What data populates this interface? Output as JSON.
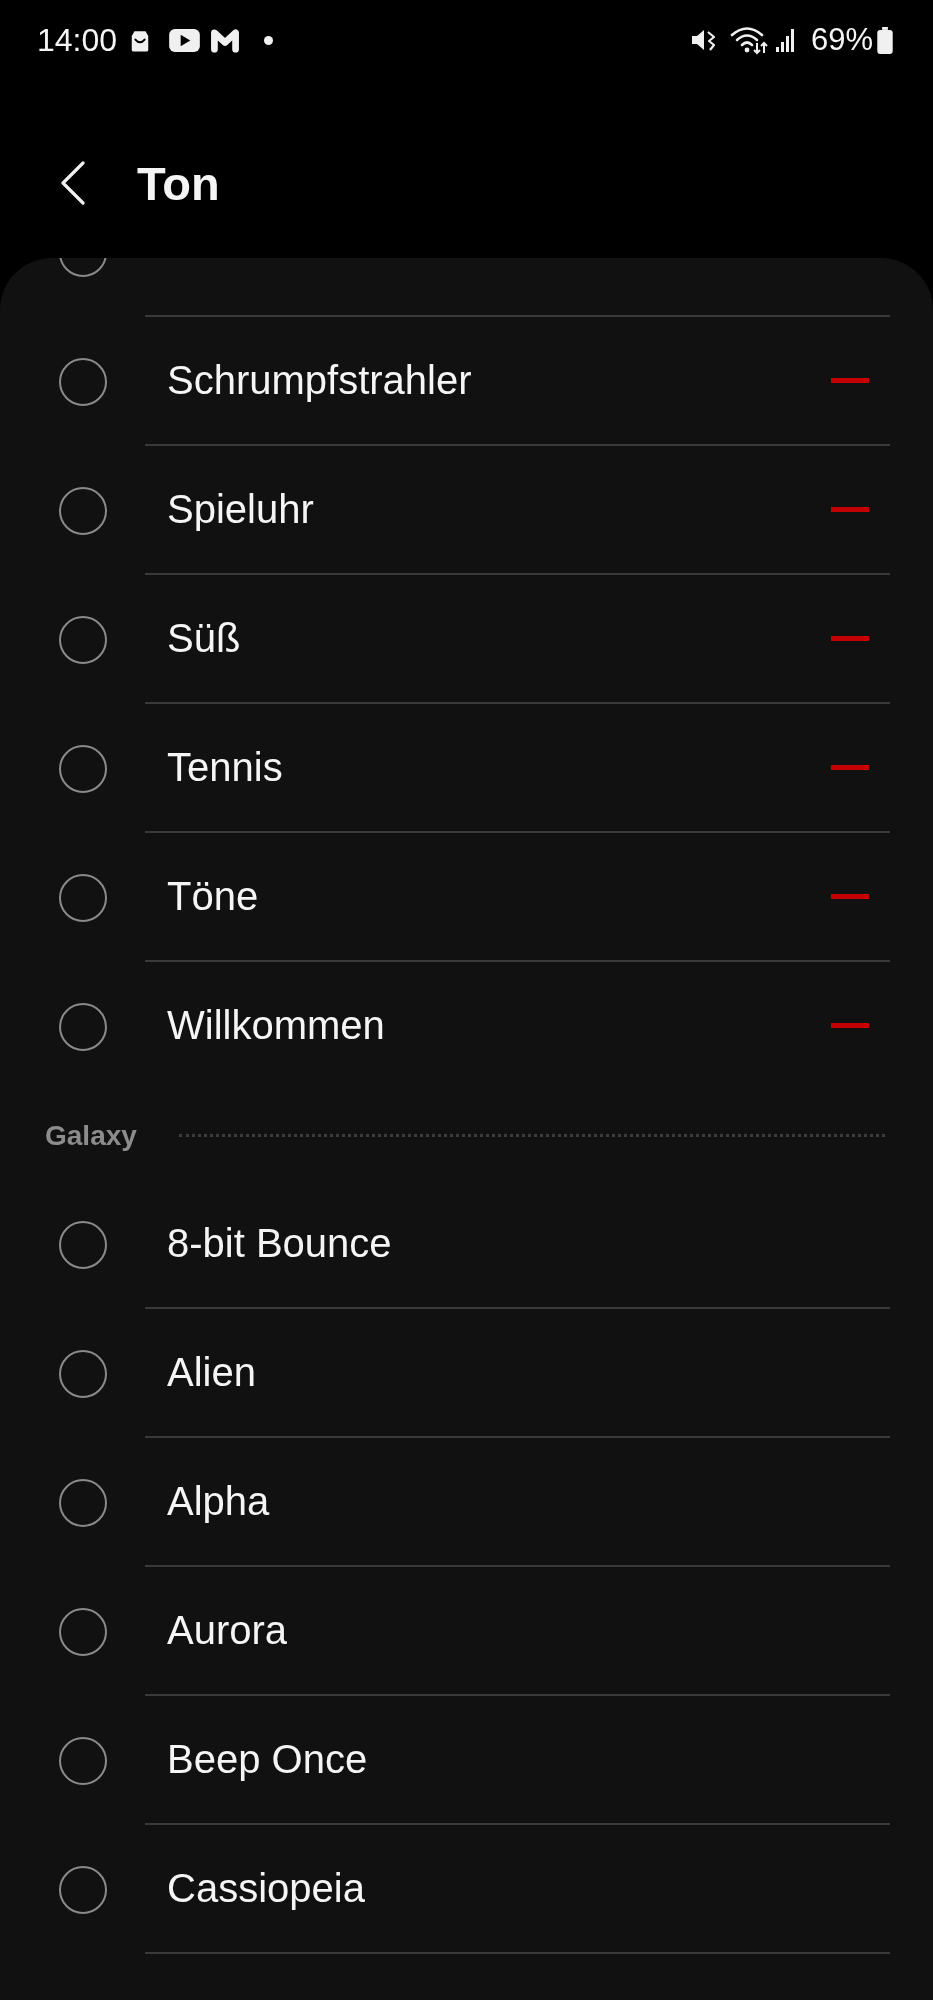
{
  "status_bar": {
    "time": "14:00",
    "battery": "69%"
  },
  "header": {
    "title": "Ton"
  },
  "sections": [
    {
      "items": [
        {
          "selected": false
        },
        {
          "name": "Schrumpfstrahler",
          "selected": false,
          "removable": true
        },
        {
          "name": "Spieluhr",
          "selected": false,
          "removable": true
        },
        {
          "name": "Süß",
          "selected": false,
          "removable": true
        },
        {
          "name": "Tennis",
          "selected": false,
          "removable": true
        },
        {
          "name": "Töne",
          "selected": false,
          "removable": true
        },
        {
          "name": "Willkommen",
          "selected": false,
          "removable": true
        }
      ]
    },
    {
      "title": "Galaxy",
      "items": [
        {
          "name": "8-bit Bounce",
          "selected": false
        },
        {
          "name": "Alien",
          "selected": false
        },
        {
          "name": "Alpha",
          "selected": false
        },
        {
          "name": "Aurora",
          "selected": false
        },
        {
          "name": "Beep Once",
          "selected": false
        },
        {
          "name": "Cassiopeia",
          "selected": false
        }
      ]
    }
  ]
}
